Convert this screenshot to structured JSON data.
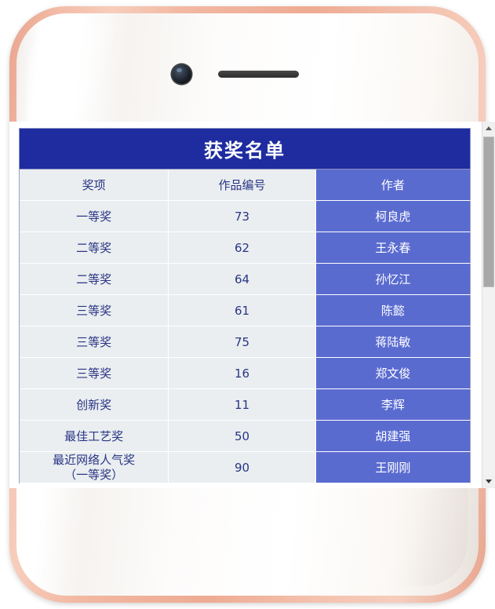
{
  "device": {
    "name": "smartphone-mockup",
    "frame_color": "#f0b49f",
    "body_color": "#ffffff",
    "camera_icon": "front-camera-icon",
    "speaker_icon": "earpiece-speaker-icon"
  },
  "app": {
    "title": "获奖名单",
    "header_bg": "#1e2ca0",
    "header_text_color": "#ffffff",
    "cell_bg": "#eaeef0",
    "cell_text_color": "#2a3585",
    "author_cell_bg": "#5a6bd0",
    "author_cell_text_color": "#ffffff"
  },
  "table": {
    "columns": [
      "奖项",
      "作品编号",
      "作者"
    ],
    "rows": [
      {
        "award": "一等奖",
        "number": "73",
        "author": "柯良虎"
      },
      {
        "award": "二等奖",
        "number": "62",
        "author": "王永春"
      },
      {
        "award": "二等奖",
        "number": "64",
        "author": "孙忆江"
      },
      {
        "award": "三等奖",
        "number": "61",
        "author": "陈懿"
      },
      {
        "award": "三等奖",
        "number": "75",
        "author": "蒋陆敏"
      },
      {
        "award": "三等奖",
        "number": "16",
        "author": "郑文俊"
      },
      {
        "award": "创新奖",
        "number": "11",
        "author": "李辉"
      },
      {
        "award": "最佳工艺奖",
        "number": "50",
        "author": "胡建强"
      },
      {
        "award": "最近网络人气奖",
        "award_line2": "（一等奖）",
        "number": "90",
        "author": "王刚刚"
      }
    ]
  },
  "scrollbar": {
    "up_arrow_icon": "scroll-up-arrow-icon",
    "down_arrow_icon": "scroll-down-arrow-icon",
    "thumb_label": "scrollbar-thumb"
  }
}
